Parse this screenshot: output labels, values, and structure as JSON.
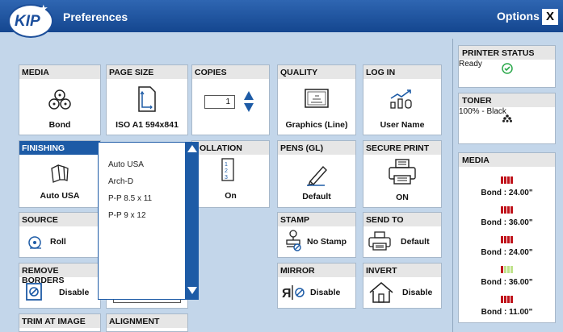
{
  "header": {
    "title": "Preferences",
    "options_label": "Options",
    "close_label": "X",
    "logo_text": "KIP"
  },
  "cards": {
    "media": {
      "title": "MEDIA",
      "value": "Bond"
    },
    "page_size": {
      "title": "PAGE SIZE",
      "value": "ISO A1 594x841"
    },
    "copies": {
      "title": "COPIES",
      "value": "1"
    },
    "quality": {
      "title": "QUALITY",
      "value": "Graphics (Line)"
    },
    "log_in": {
      "title": "LOG IN",
      "value": "User Name"
    },
    "finishing": {
      "title": "FINISHING",
      "value": "Auto USA"
    },
    "collation": {
      "title": "OLLATION",
      "value": "On"
    },
    "pens": {
      "title": "PENS (GL)",
      "value": "Default"
    },
    "secure_print": {
      "title": "SECURE PRINT",
      "value": "ON"
    },
    "source": {
      "title": "SOURCE",
      "value": "Roll"
    },
    "stamp": {
      "title": "STAMP",
      "value": "No Stamp"
    },
    "send_to": {
      "title": "SEND TO",
      "value": "Default"
    },
    "remove_borders": {
      "title": "REMOVE BORDERS",
      "value": "Disable"
    },
    "mirror": {
      "title": "MIRROR",
      "value": "Disable"
    },
    "invert": {
      "title": "INVERT",
      "value": "Disable"
    },
    "trim": {
      "title": "TRIM AT IMAGE"
    },
    "alignment": {
      "title": "ALIGNMENT"
    }
  },
  "finishing_dropdown": {
    "options": [
      "Auto USA",
      "Arch-D",
      "P-P  8.5 x 11",
      "P-P  9 x 12"
    ]
  },
  "sidebar": {
    "printer_status": {
      "title": "PRINTER STATUS",
      "value": "Ready"
    },
    "toner": {
      "title": "TONER",
      "value": "100% - Black"
    },
    "media": {
      "title": "MEDIA",
      "rolls": [
        {
          "label": "Bond : 24.00\"",
          "level": 1.0
        },
        {
          "label": "Bond : 36.00\"",
          "level": 1.0
        },
        {
          "label": "Bond : 24.00\"",
          "level": 1.0
        },
        {
          "label": "Bond : 36.00\"",
          "level": 0.25
        },
        {
          "label": "Bond : 11.00\"",
          "level": 1.0
        }
      ]
    }
  },
  "colors": {
    "title_bar": "#1d5ba6",
    "background": "#c3d6ea",
    "roll_full": "#c0121a",
    "roll_empty": "#bfe28a",
    "ready": "#2aa84a"
  }
}
